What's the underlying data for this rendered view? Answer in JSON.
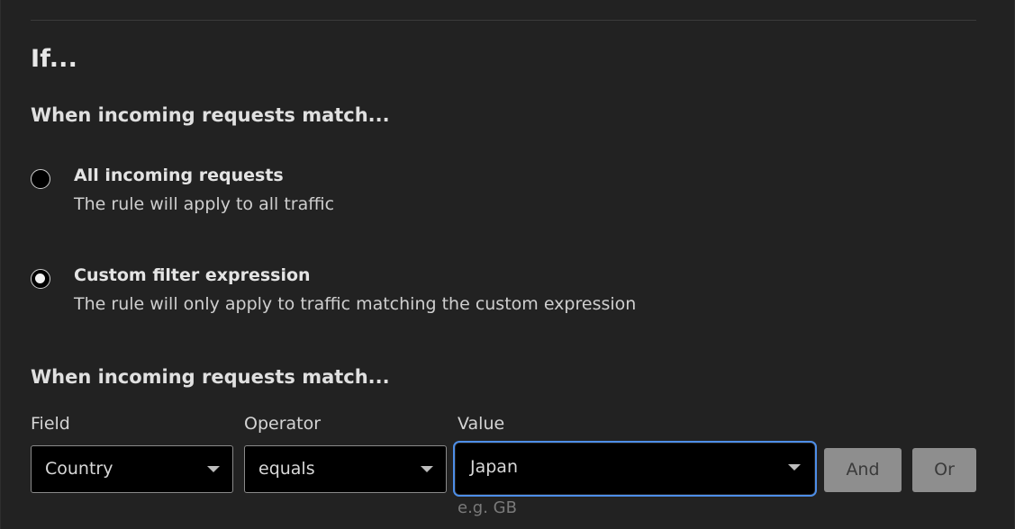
{
  "section": {
    "title": "If...",
    "match_heading": "When incoming requests match...",
    "builder_heading": "When incoming requests match..."
  },
  "options": [
    {
      "title": "All incoming requests",
      "description": "The rule will apply to all traffic",
      "selected": false
    },
    {
      "title": "Custom filter expression",
      "description": "The rule will only apply to traffic matching the custom expression",
      "selected": true
    }
  ],
  "expression": {
    "field_label": "Field",
    "field_value": "Country",
    "operator_label": "Operator",
    "operator_value": "equals",
    "value_label": "Value",
    "value_value": "Japan",
    "value_hint": "e.g. GB",
    "and_label": "And",
    "or_label": "Or"
  },
  "colors": {
    "background": "#222222",
    "focus_ring": "#4d8ee8",
    "button_disabled": "#8e8e8e"
  }
}
